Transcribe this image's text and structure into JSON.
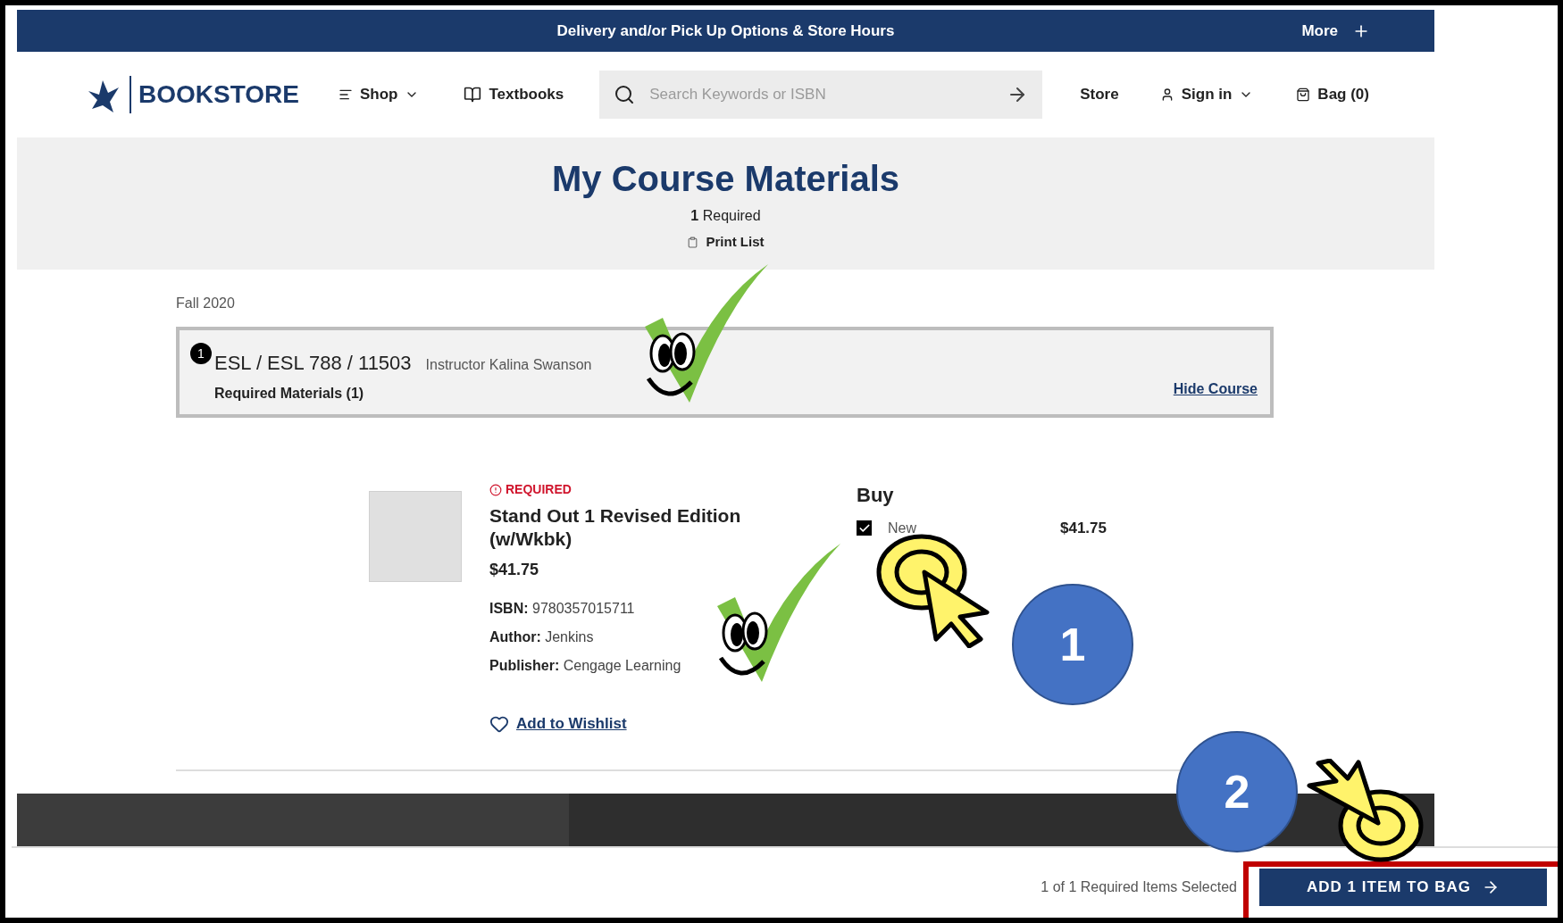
{
  "announcement": {
    "text": "Delivery and/or Pick Up Options & Store Hours",
    "more": "More"
  },
  "nav": {
    "logo": "BOOKSTORE",
    "items": [
      {
        "kind": "menu",
        "label": "Shop"
      },
      {
        "kind": "link",
        "label": "Textbooks"
      }
    ],
    "search": {
      "placeholder": "Search Keywords or ISBN"
    },
    "store": "Store",
    "sign_in": "Sign in",
    "bag": "Bag (0)"
  },
  "header": {
    "title": "My Course Materials",
    "required_count": "1",
    "required_label": "Required",
    "print": "Print List"
  },
  "term": "Fall 2020",
  "course": {
    "number": "1",
    "name": "ESL / ESL 788 / 11503",
    "instructor": "Instructor Kalina Swanson",
    "materials": "Required Materials (1)",
    "hide": "Hide Course"
  },
  "item": {
    "badge": "REQUIRED",
    "title": "Stand Out 1 Revised Edition (w/Wkbk)",
    "price": "$41.75",
    "details": [
      {
        "label": "ISBN:",
        "value": "9780357015711"
      },
      {
        "label": "Author:",
        "value": "Jenkins"
      },
      {
        "label": "Publisher:",
        "value": "Cengage Learning"
      }
    ],
    "wishlist": "Add to Wishlist",
    "buy": {
      "heading": "Buy",
      "options": [
        {
          "label": "New",
          "price": "$41.75",
          "checked": true
        }
      ]
    }
  },
  "bottom_bar": {
    "status": "1 of 1 Required Items Selected",
    "button": "ADD 1 ITEM TO BAG"
  },
  "callouts": [
    {
      "label": "1"
    },
    {
      "label": "2"
    }
  ]
}
